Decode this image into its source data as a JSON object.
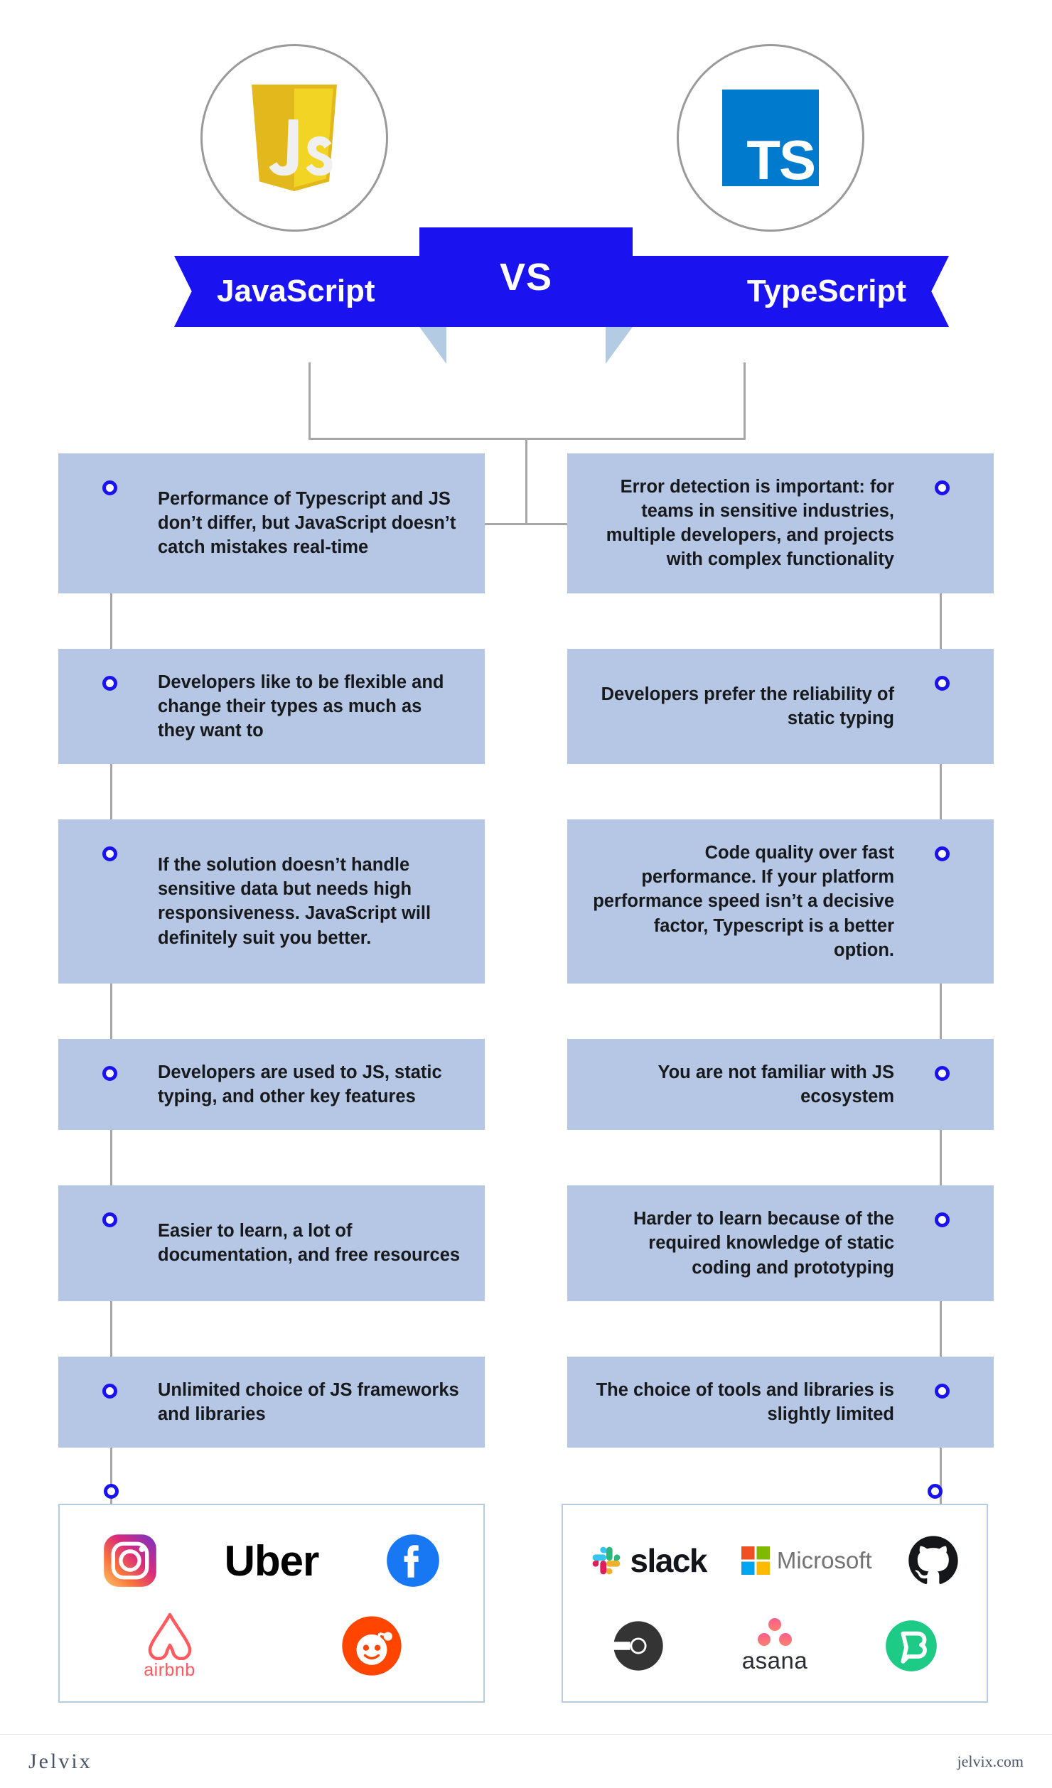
{
  "header": {
    "left_logo": {
      "icon": "javascript-logo",
      "text": "JS",
      "color": "#e9c91f"
    },
    "right_logo": {
      "icon": "typescript-logo",
      "text": "TS",
      "color": "#007acc"
    },
    "banner": {
      "left_label": "JavaScript",
      "center_label": "VS",
      "right_label": "TypeScript",
      "ribbon_color": "#1a13f0",
      "fold_color": "#b4cbe4"
    }
  },
  "theme": {
    "box_fill": "#b5c7e4",
    "marker_color": "#1a13f0",
    "connector_color": "#a7a7a7",
    "logo_box_border": "#b8cbe2",
    "text_color": "#18191c"
  },
  "comparison": {
    "rows": [
      {
        "left": "Performance of Typescript and JS don’t differ, but JavaScript doesn’t catch mistakes real-time",
        "right": "Error detection is important: for teams in sensitive industries, multiple developers, and projects with complex functionality"
      },
      {
        "left": "Developers like to be flexible and change their types as much as they want to",
        "right": "Developers prefer the reliability of static typing"
      },
      {
        "left": "If the solution doesn’t handle sensitive data but needs high responsiveness. JavaScript will definitely suit you better.",
        "right": "Code quality over fast performance. If your platform performance speed isn’t a decisive factor, Typescript is a better option."
      },
      {
        "left": "Developers are used to JS, static typing, and other key features",
        "right": "You are not familiar with JS ecosystem"
      },
      {
        "left": "Easier to learn, a lot of documentation, and free resources",
        "right": "Harder to learn because of the required knowledge of static coding and prototyping"
      },
      {
        "left": "Unlimited choice of JS frameworks and libraries",
        "right": "The choice of tools and libraries is slightly limited"
      }
    ]
  },
  "logos": {
    "left_users": [
      {
        "name": "instagram",
        "label": "Instagram"
      },
      {
        "name": "uber",
        "label": "Uber"
      },
      {
        "name": "facebook",
        "label": "Facebook"
      },
      {
        "name": "airbnb",
        "label": "airbnb"
      },
      {
        "name": "reddit",
        "label": "Reddit"
      }
    ],
    "right_users": [
      {
        "name": "slack",
        "label": "slack"
      },
      {
        "name": "microsoft",
        "label": "Microsoft"
      },
      {
        "name": "github",
        "label": "GitHub"
      },
      {
        "name": "circleci",
        "label": "CircleCI"
      },
      {
        "name": "asana",
        "label": "asana"
      },
      {
        "name": "bitpanda",
        "label": "Bitpanda"
      }
    ]
  },
  "footer": {
    "brand": "Jelvix",
    "url": "jelvix.com"
  }
}
